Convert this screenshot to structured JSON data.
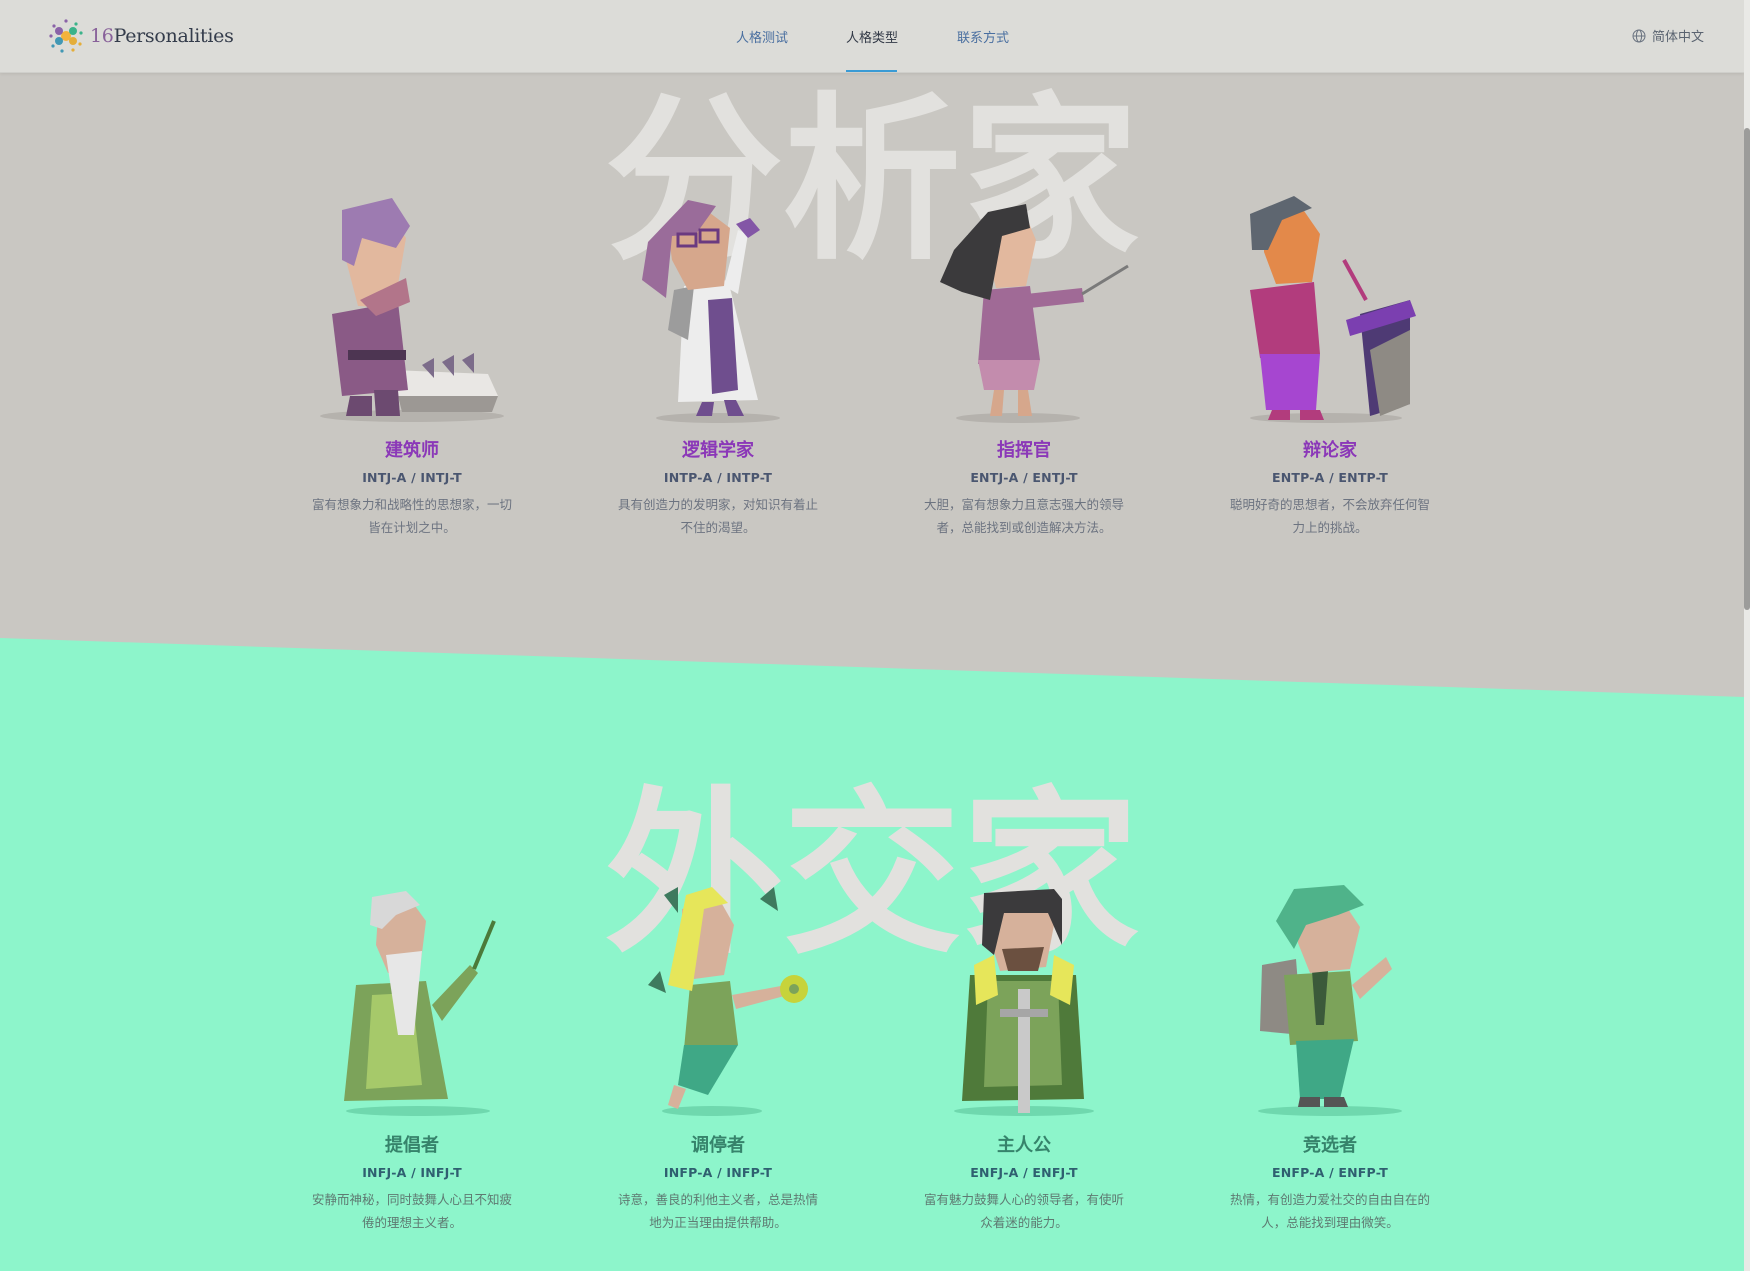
{
  "header": {
    "logo_number": "16",
    "logo_word": "Personalities",
    "nav": [
      {
        "label": "人格测试",
        "active": false
      },
      {
        "label": "人格类型",
        "active": true
      },
      {
        "label": "联系方式",
        "active": false
      }
    ],
    "language": "简体中文"
  },
  "sections": {
    "analysts": {
      "watermark": "分析家",
      "bg_color": "#c9c7c2",
      "cards": [
        {
          "name": "建筑师",
          "code": "INTJ-A / INTJ-T",
          "desc": "富有想象力和战略性的思想家，一切皆在计划之中。"
        },
        {
          "name": "逻辑学家",
          "code": "INTP-A / INTP-T",
          "desc": "具有创造力的发明家，对知识有着止不住的渴望。"
        },
        {
          "name": "指挥官",
          "code": "ENTJ-A / ENTJ-T",
          "desc": "大胆，富有想象力且意志强大的领导者，总能找到或创造解决方法。"
        },
        {
          "name": "辩论家",
          "code": "ENTP-A / ENTP-T",
          "desc": "聪明好奇的思想者，不会放弃任何智力上的挑战。"
        }
      ]
    },
    "diplomats": {
      "watermark": "外交家",
      "bg_color": "#8df5cb",
      "cards": [
        {
          "name": "提倡者",
          "code": "INFJ-A / INFJ-T",
          "desc": "安静而神秘，同时鼓舞人心且不知疲倦的理想主义者。"
        },
        {
          "name": "调停者",
          "code": "INFP-A / INFP-T",
          "desc": "诗意，善良的利他主义者，总是热情地为正当理由提供帮助。"
        },
        {
          "name": "主人公",
          "code": "ENFJ-A / ENFJ-T",
          "desc": "富有魅力鼓舞人心的领导者，有使听众着迷的能力。"
        },
        {
          "name": "竞选者",
          "code": "ENFP-A / ENFP-T",
          "desc": "热情，有创造力爱社交的自由自在的人，总能找到理由微笑。"
        }
      ]
    }
  },
  "icons": {
    "logo": "logo-dots-icon",
    "language": "globe-icon",
    "figures": [
      "architect-figure",
      "logician-figure",
      "commander-figure",
      "debater-figure",
      "advocate-figure",
      "mediator-figure",
      "protagonist-figure",
      "campaigner-figure"
    ]
  },
  "colors": {
    "analyst_name": "#8b38b8",
    "diplomat_name": "#36836b",
    "nav_active_underline": "#3a9bd5"
  }
}
